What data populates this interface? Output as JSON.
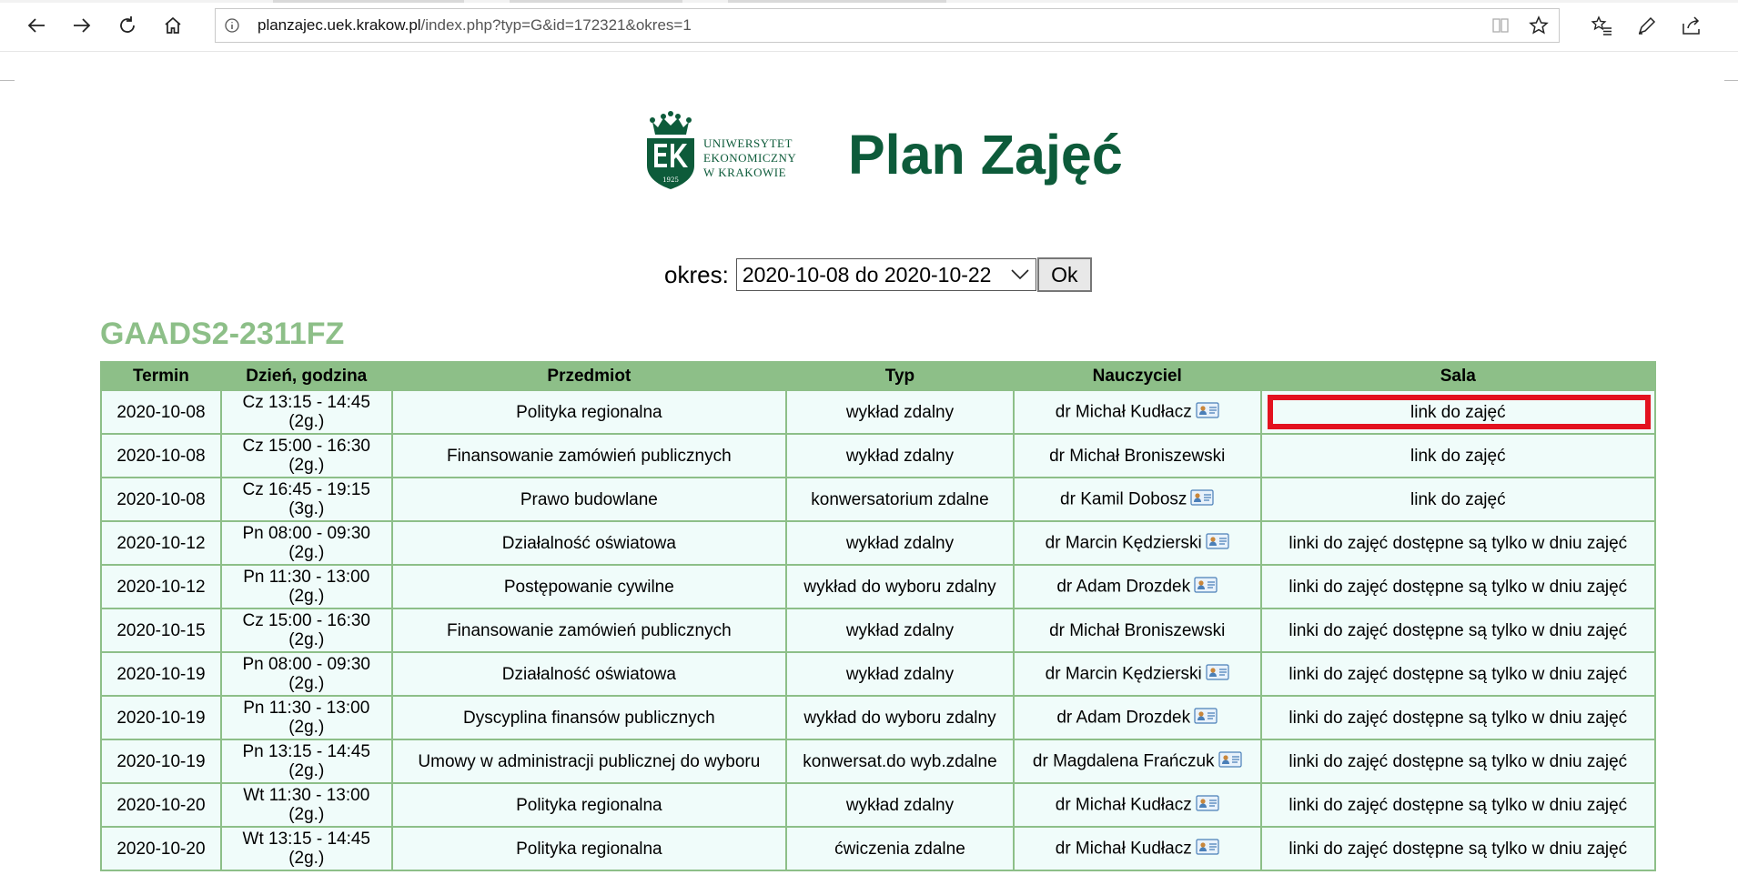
{
  "browser": {
    "url_host": "planzajec.uek.krakow.pl",
    "url_path": "/index.php?typ=G&id=172321&okres=1"
  },
  "header": {
    "logo_lines": [
      "UNIWERSYTET",
      "EKONOMICZNY",
      "W KRAKOWIE"
    ],
    "logo_year": "1925",
    "title": "Plan Zajęć"
  },
  "period": {
    "label": "okres:",
    "selected": "2020-10-08 do 2020-10-22",
    "ok_label": "Ok"
  },
  "group_title": "GAADS2-2311FZ",
  "colors": {
    "brand_green": "#0d5b3a",
    "table_header": "#8dbf88",
    "cell_bg": "#f0fcfa",
    "highlight": "#e3121f"
  },
  "table": {
    "headers": [
      "Termin",
      "Dzień, godzina",
      "Przedmiot",
      "Typ",
      "Nauczyciel",
      "Sala"
    ],
    "rows": [
      {
        "termin": "2020-10-08",
        "dzien": "Cz 13:15 - 14:45",
        "godz": "(2g.)",
        "przedmiot": "Polityka regionalna",
        "typ": "wykład zdalny",
        "nauczyciel": "dr Michał Kudłacz",
        "card": true,
        "sala": "link do zajęć",
        "link": true,
        "highlight": true
      },
      {
        "termin": "2020-10-08",
        "dzien": "Cz 15:00 - 16:30",
        "godz": "(2g.)",
        "przedmiot": "Finansowanie zamówień publicznych",
        "typ": "wykład zdalny",
        "nauczyciel": "dr Michał Broniszewski",
        "card": false,
        "sala": "link do zajęć",
        "link": true,
        "highlight": false
      },
      {
        "termin": "2020-10-08",
        "dzien": "Cz 16:45 - 19:15",
        "godz": "(3g.)",
        "przedmiot": "Prawo budowlane",
        "typ": "konwersatorium zdalne",
        "nauczyciel": "dr Kamil Dobosz",
        "card": true,
        "sala": "link do zajęć",
        "link": true,
        "highlight": false
      },
      {
        "termin": "2020-10-12",
        "dzien": "Pn 08:00 - 09:30",
        "godz": "(2g.)",
        "przedmiot": "Działalność oświatowa",
        "typ": "wykład zdalny",
        "nauczyciel": "dr Marcin Kędzierski",
        "card": true,
        "sala": "linki do zajęć dostępne są tylko w dniu zajęć",
        "link": false,
        "highlight": false
      },
      {
        "termin": "2020-10-12",
        "dzien": "Pn 11:30 - 13:00",
        "godz": "(2g.)",
        "przedmiot": "Postępowanie cywilne",
        "typ": "wykład do wyboru zdalny",
        "nauczyciel": "dr Adam Drozdek",
        "card": true,
        "sala": "linki do zajęć dostępne są tylko w dniu zajęć",
        "link": false,
        "highlight": false
      },
      {
        "termin": "2020-10-15",
        "dzien": "Cz 15:00 - 16:30",
        "godz": "(2g.)",
        "przedmiot": "Finansowanie zamówień publicznych",
        "typ": "wykład zdalny",
        "nauczyciel": "dr Michał Broniszewski",
        "card": false,
        "sala": "linki do zajęć dostępne są tylko w dniu zajęć",
        "link": false,
        "highlight": false
      },
      {
        "termin": "2020-10-19",
        "dzien": "Pn 08:00 - 09:30",
        "godz": "(2g.)",
        "przedmiot": "Działalność oświatowa",
        "typ": "wykład zdalny",
        "nauczyciel": "dr Marcin Kędzierski",
        "card": true,
        "sala": "linki do zajęć dostępne są tylko w dniu zajęć",
        "link": false,
        "highlight": false
      },
      {
        "termin": "2020-10-19",
        "dzien": "Pn 11:30 - 13:00",
        "godz": "(2g.)",
        "przedmiot": "Dyscyplina finansów publicznych",
        "typ": "wykład do wyboru zdalny",
        "nauczyciel": "dr Adam Drozdek",
        "card": true,
        "sala": "linki do zajęć dostępne są tylko w dniu zajęć",
        "link": false,
        "highlight": false
      },
      {
        "termin": "2020-10-19",
        "dzien": "Pn 13:15 - 14:45",
        "godz": "(2g.)",
        "przedmiot": "Umowy w administracji publicznej do wyboru",
        "typ": "konwersat.do wyb.zdalne",
        "nauczyciel": "dr Magdalena Frańczuk",
        "card": true,
        "sala": "linki do zajęć dostępne są tylko w dniu zajęć",
        "link": false,
        "highlight": false
      },
      {
        "termin": "2020-10-20",
        "dzien": "Wt 11:30 - 13:00",
        "godz": "(2g.)",
        "przedmiot": "Polityka regionalna",
        "typ": "wykład zdalny",
        "nauczyciel": "dr Michał Kudłacz",
        "card": true,
        "sala": "linki do zajęć dostępne są tylko w dniu zajęć",
        "link": false,
        "highlight": false
      },
      {
        "termin": "2020-10-20",
        "dzien": "Wt 13:15 - 14:45",
        "godz": "(2g.)",
        "przedmiot": "Polityka regionalna",
        "typ": "ćwiczenia zdalne",
        "nauczyciel": "dr Michał Kudłacz",
        "card": true,
        "sala": "linki do zajęć dostępne są tylko w dniu zajęć",
        "link": false,
        "highlight": false
      }
    ]
  }
}
